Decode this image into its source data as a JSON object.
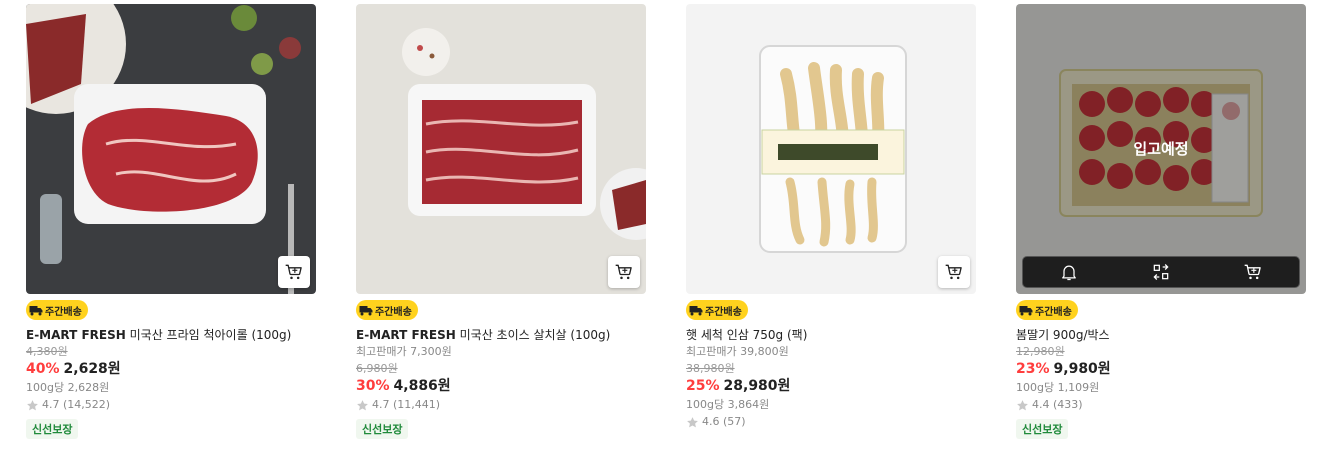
{
  "icons": {
    "cart": "cart-icon",
    "bell": "bell-icon",
    "compare": "compare-icon",
    "star": "star-icon",
    "delivery": "delivery-truck-icon"
  },
  "colors": {
    "discount": "#ff3d3d",
    "weekly_badge_bg": "#ffd21e",
    "fresh_badge_text": "#1f8a3a",
    "star": "#c8c8c8"
  },
  "products": [
    {
      "weekly_badge": "주간배송",
      "brand": "E-MART FRESH",
      "name": " 미국산 프라임 척아이롤 (100g)",
      "original_price": "4,380원",
      "discount_pct": "40%",
      "sale_price": "2,628원",
      "unit_price": "100g당 2,628원",
      "rating": "4.7 (14,522)",
      "fresh_badge": "신선보장"
    },
    {
      "weekly_badge": "주간배송",
      "brand": "E-MART FRESH",
      "name": " 미국산 초이스 살치살 (100g)",
      "max_price_note": "최고판매가 7,300원",
      "original_price": "6,980원",
      "discount_pct": "30%",
      "sale_price": "4,886원",
      "rating": "4.7 (11,441)",
      "fresh_badge": "신선보장"
    },
    {
      "weekly_badge": "주간배송",
      "name": "햇 세척 인삼 750g (팩)",
      "max_price_note": "최고판매가 39,800원",
      "original_price": "38,980원",
      "discount_pct": "25%",
      "sale_price": "28,980원",
      "unit_price": "100g당 3,864원",
      "rating": "4.6 (57)"
    },
    {
      "weekly_badge": "주간배송",
      "name": "봄딸기 900g/박스",
      "original_price": "12,980원",
      "discount_pct": "23%",
      "sale_price": "9,980원",
      "unit_price": "100g당 1,109원",
      "rating": "4.4 (433)",
      "fresh_badge": "신선보장",
      "soldout_text": "입고예정"
    }
  ]
}
